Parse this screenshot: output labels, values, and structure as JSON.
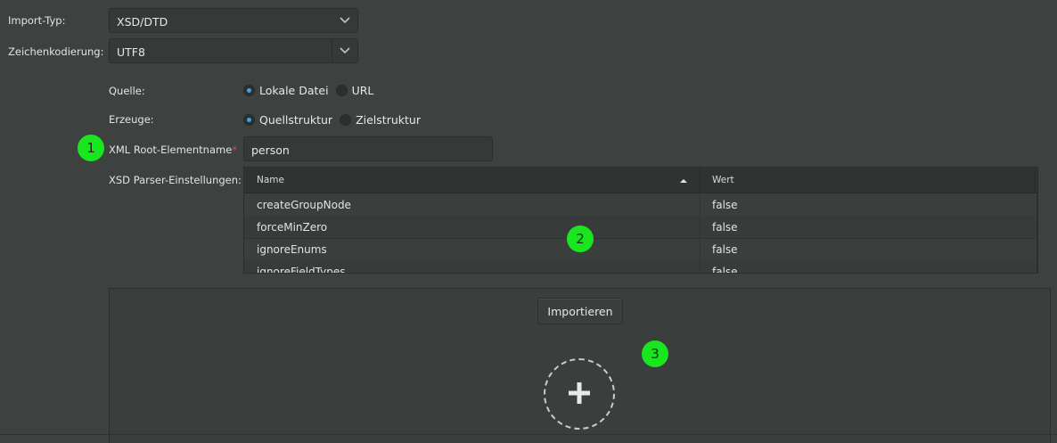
{
  "import_type": {
    "label": "Import-Typ:",
    "value": "XSD/DTD"
  },
  "encoding": {
    "label": "Zeichenkodierung:",
    "value": "UTF8"
  },
  "source": {
    "label": "Quelle:",
    "options": [
      "Lokale Datei",
      "URL"
    ],
    "selected": "Lokale Datei"
  },
  "generate": {
    "label": "Erzeuge:",
    "options": [
      "Quellstruktur",
      "Zielstruktur"
    ],
    "selected": "Quellstruktur"
  },
  "root_element": {
    "label": "XML Root-Elementname",
    "required_mark": "*",
    "value": "person"
  },
  "parser_settings": {
    "label": "XSD Parser-Einstellungen:",
    "columns": [
      "Name",
      "Wert"
    ],
    "rows": [
      {
        "name": "createGroupNode",
        "value": "false"
      },
      {
        "name": "forceMinZero",
        "value": "false"
      },
      {
        "name": "ignoreEnums",
        "value": "false"
      },
      {
        "name": "ignoreFieldTypes",
        "value": "false"
      }
    ]
  },
  "import_button": "Importieren",
  "badges": [
    "1",
    "2",
    "3"
  ],
  "colors": {
    "badge": "#19e61e",
    "radio_checked": "#3fa3e5",
    "required": "#e04848"
  }
}
